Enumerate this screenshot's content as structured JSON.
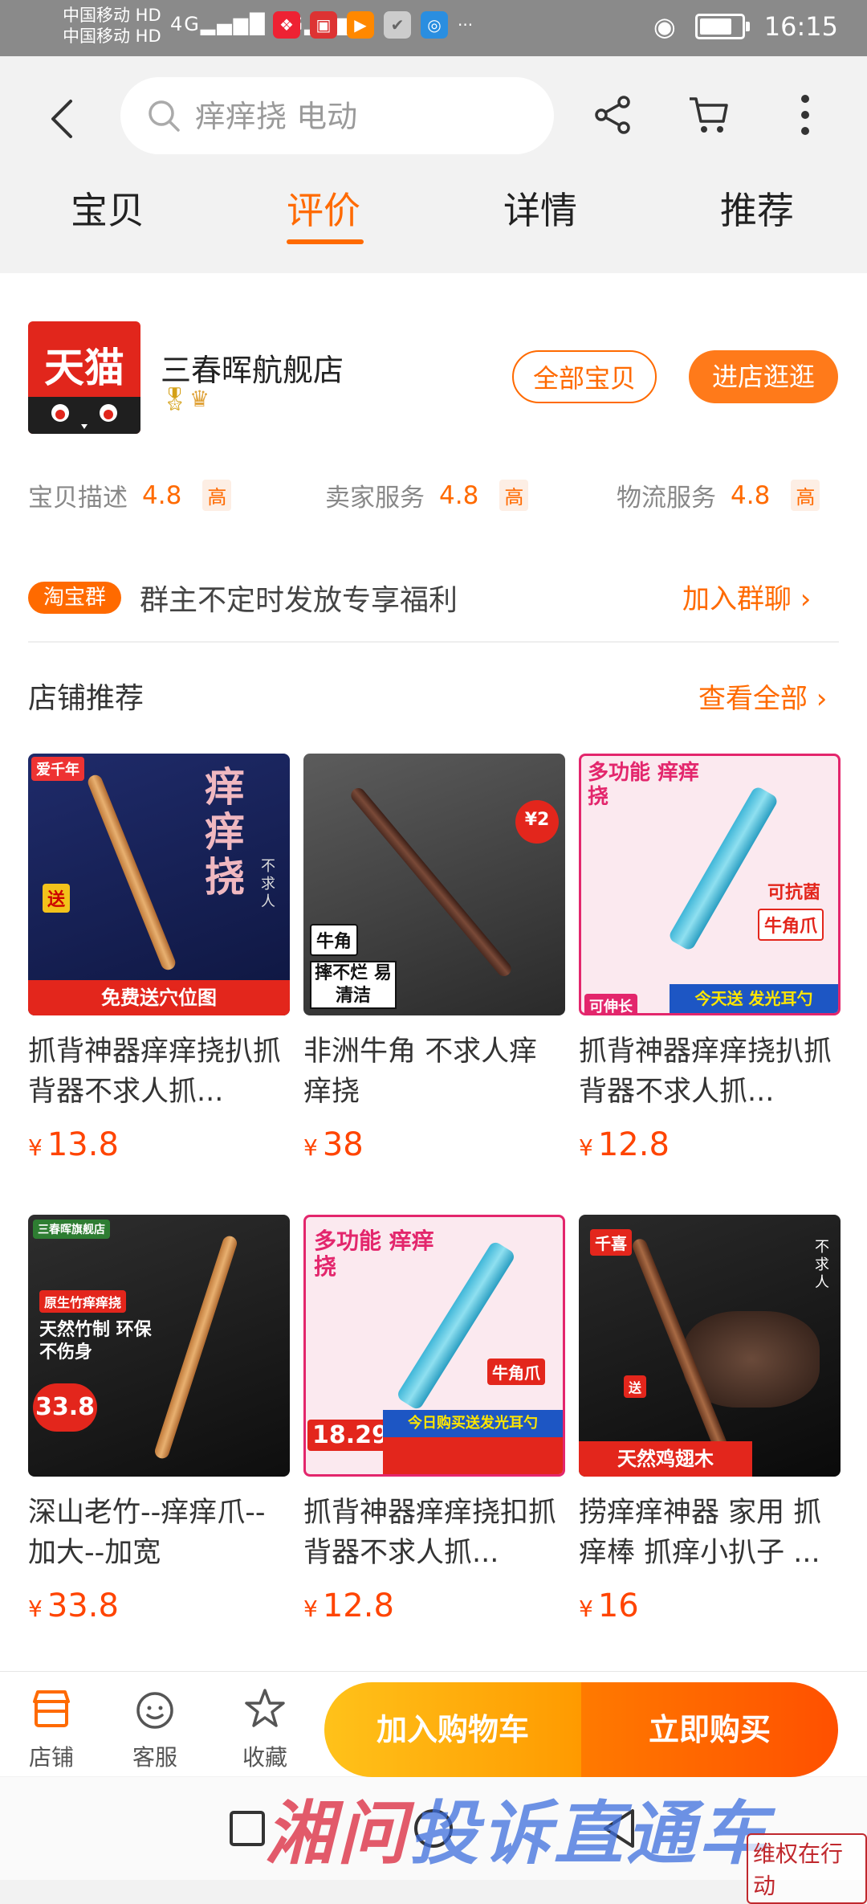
{
  "status_bar": {
    "carrier1": "中国移动 HD",
    "carrier2": "中国移动 HD",
    "signal": "4G▂▄▆█ 4G▂▄▆█",
    "time": "16:15",
    "more": "···"
  },
  "header": {
    "search_placeholder": "痒痒挠 电动",
    "tabs": [
      "宝贝",
      "评价",
      "详情",
      "推荐"
    ],
    "active_tab": 1
  },
  "shop": {
    "logo_text": "天猫",
    "name": "三春晖航舰店",
    "all_items_btn": "全部宝贝",
    "enter_shop_btn": "进店逛逛",
    "ratings": [
      {
        "label": "宝贝描述",
        "score": "4.8",
        "level": "高"
      },
      {
        "label": "卖家服务",
        "score": "4.8",
        "level": "高"
      },
      {
        "label": "物流服务",
        "score": "4.8",
        "level": "高"
      }
    ],
    "group_tag": "淘宝群",
    "group_text": "群主不定时发放专享福利",
    "join_group": "加入群聊 ›"
  },
  "recommend": {
    "title": "店铺推荐",
    "see_all": "查看全部 ›",
    "products": [
      {
        "title": "抓背神器痒痒挠扒抓背器不求人抓...",
        "price": "13.8",
        "img": {
          "big": "痒痒挠",
          "sub": "不求人",
          "tag": "爱千年",
          "caption": "免费送穴位图",
          "badge": "送"
        }
      },
      {
        "title": "非洲牛角 不求人痒痒挠",
        "price": "38",
        "img": {
          "tag": "牛角",
          "grid": "摔不烂 易清洁",
          "badge": "¥2"
        }
      },
      {
        "title": "抓背神器痒痒挠扒抓背器不求人抓...",
        "price": "12.8",
        "img": {
          "big": "多功能 痒痒挠",
          "sub": "牛角爪",
          "tag": "可抗菌",
          "caption": "今天送 发光耳勺",
          "badge": "可伸长"
        }
      },
      {
        "title": "深山老竹--痒痒爪--加大--加宽",
        "price": "33.8",
        "img": {
          "big": "天然竹制 环保不伤身",
          "sub": "原生竹痒痒挠",
          "tag": "三春晖旗舰店",
          "badge": "33.8"
        }
      },
      {
        "title": "抓背神器痒痒挠扣抓背器不求人抓...",
        "price": "12.8",
        "img": {
          "big": "多功能 痒痒挠",
          "sub": "牛角爪",
          "caption": "今日购买送发光耳勺",
          "badge": "18.29"
        }
      },
      {
        "title": "捞痒痒神器  家用 抓痒棒 抓痒小扒子  ...",
        "price": "16",
        "img": {
          "tag": "千喜",
          "sub": "不求人",
          "caption": "天然鸡翅木",
          "badge": "送"
        }
      }
    ]
  },
  "bottom_bar": {
    "shop": "店铺",
    "service": "客服",
    "favorite": "收藏",
    "add_cart": "加入购物车",
    "buy_now": "立即购买"
  },
  "watermark": {
    "left": "湘问",
    "right": "投诉直通车",
    "stamp": "维权在行动"
  }
}
